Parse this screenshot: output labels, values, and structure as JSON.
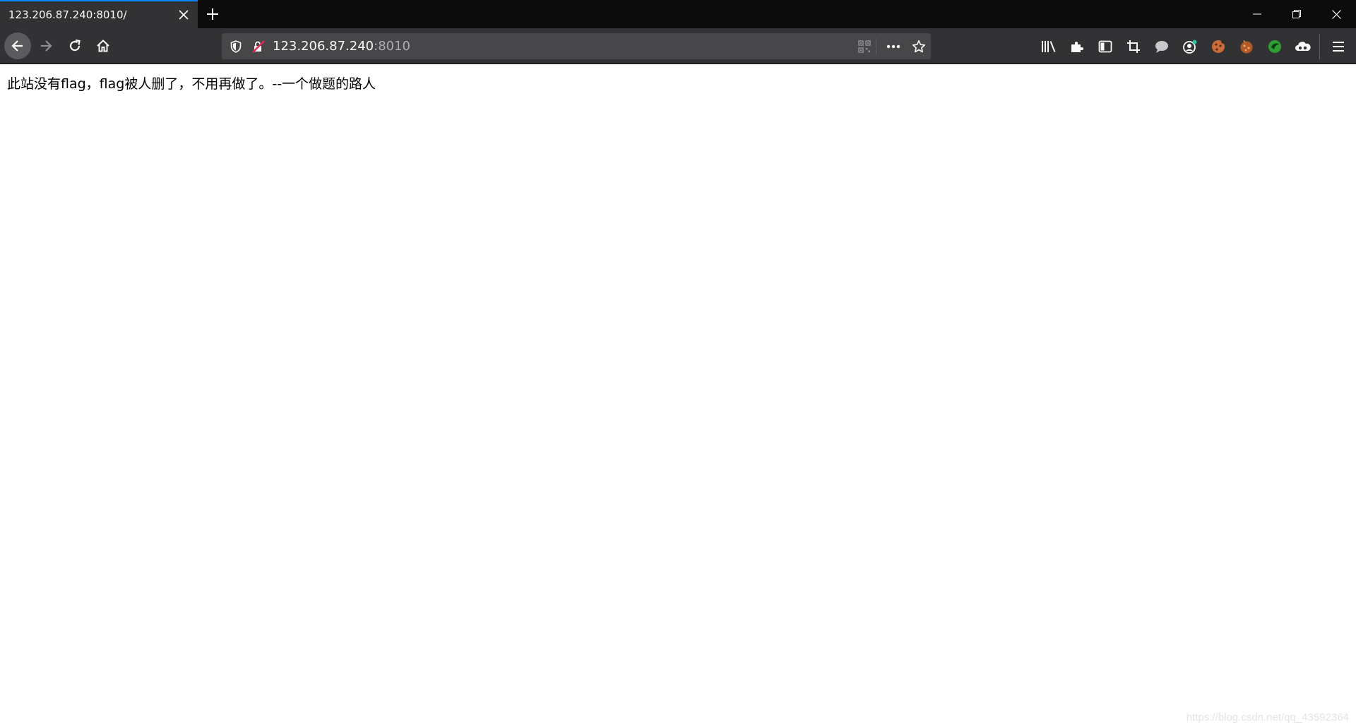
{
  "browser": {
    "tab": {
      "title": "123.206.87.240:8010/"
    },
    "address_bar": {
      "host": "123.206.87.240",
      "port": ":8010"
    },
    "accent_color": "#0a84ff",
    "toolbar_icons": [
      "library-icon",
      "extensions-icon",
      "sidebar-icon",
      "screenshot-crop-icon",
      "chat-icon",
      "account-icon",
      "cookie-icon",
      "cookie-editor-icon",
      "green-extension-icon",
      "cloud-extension-icon",
      "menu-icon"
    ]
  },
  "page": {
    "body_text": "此站没有flag，flag被人删了，不用再做了。--一个做题的路人"
  },
  "watermark": "https://blog.csdn.net/qq_43592364"
}
